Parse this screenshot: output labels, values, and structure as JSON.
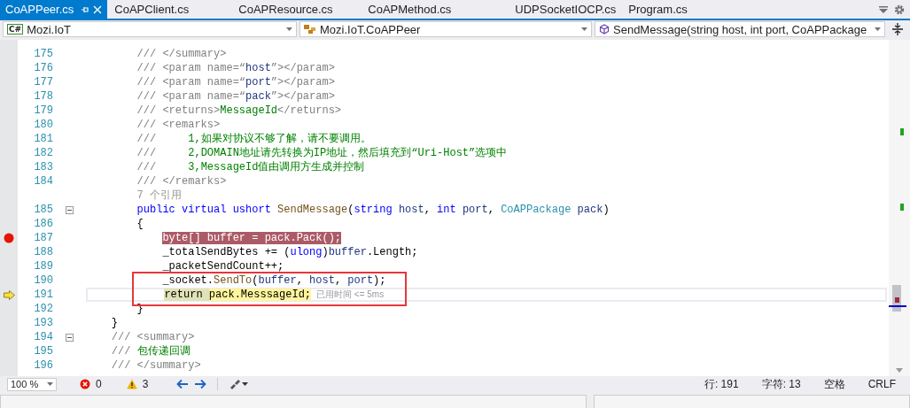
{
  "tabs": [
    {
      "label": "CoAPPeer.cs",
      "selected": true
    },
    {
      "label": "CoAPClient.cs",
      "selected": false
    },
    {
      "label": "CoAPResource.cs",
      "selected": false
    },
    {
      "label": "CoAPMethod.cs",
      "selected": false
    },
    {
      "label": "UDPSocketIOCP.cs",
      "selected": false
    },
    {
      "label": "Program.cs",
      "selected": false
    }
  ],
  "navigation_bar": {
    "project": {
      "icon_label": "C#",
      "text": "Mozi.IoT"
    },
    "type": {
      "text": "Mozi.IoT.CoAPPeer"
    },
    "member": {
      "text": "SendMessage(string host, int port, CoAPPackage"
    }
  },
  "editor": {
    "lines": [
      {
        "number": "175",
        "tokens": [
          {
            "text": "        /// </summary>",
            "kind": "doc"
          }
        ]
      },
      {
        "number": "176",
        "tokens": [
          {
            "text": "        /// <param name=“",
            "kind": "doc"
          },
          {
            "text": "host",
            "kind": "param"
          },
          {
            "text": "”></param>",
            "kind": "doc"
          }
        ]
      },
      {
        "number": "177",
        "tokens": [
          {
            "text": "        /// <param name=“",
            "kind": "doc"
          },
          {
            "text": "port",
            "kind": "param"
          },
          {
            "text": "”></param>",
            "kind": "doc"
          }
        ]
      },
      {
        "number": "178",
        "tokens": [
          {
            "text": "        /// <param name=“",
            "kind": "doc"
          },
          {
            "text": "pack",
            "kind": "param"
          },
          {
            "text": "”></param>",
            "kind": "doc"
          }
        ]
      },
      {
        "number": "179",
        "tokens": [
          {
            "text": "        /// <returns>",
            "kind": "doc"
          },
          {
            "text": "MessageId",
            "kind": "comment"
          },
          {
            "text": "</returns>",
            "kind": "doc"
          }
        ]
      },
      {
        "number": "180",
        "tokens": [
          {
            "text": "        /// <remarks>",
            "kind": "doc"
          }
        ]
      },
      {
        "number": "181",
        "tokens": [
          {
            "text": "        ///",
            "kind": "doc"
          },
          {
            "text": "     1,如果对协议不够了解，请不要调用。",
            "kind": "comment"
          }
        ]
      },
      {
        "number": "182",
        "tokens": [
          {
            "text": "        ///",
            "kind": "doc"
          },
          {
            "text": "     2,DOMAIN地址请先转换为IP地址，然后填充到“Uri-Host”选项中",
            "kind": "comment"
          }
        ]
      },
      {
        "number": "183",
        "tokens": [
          {
            "text": "        ///",
            "kind": "doc"
          },
          {
            "text": "     3,MessageId值由调用方生成并控制",
            "kind": "comment"
          }
        ]
      },
      {
        "number": "184",
        "tokens": [
          {
            "text": "        /// </remarks>",
            "kind": "doc"
          }
        ]
      },
      {
        "tokens": [
          {
            "text": "        7 个引用",
            "kind": "lens"
          }
        ]
      },
      {
        "number": "185",
        "collapsible": true,
        "tokens": [
          {
            "text": "        public virtual ushort",
            "kind": "keyword"
          },
          {
            "text": " SendMessage",
            "kind": "method"
          },
          {
            "text": "(",
            "kind": "plain"
          },
          {
            "text": "string",
            "kind": "keyword"
          },
          {
            "text": " host",
            "kind": "param"
          },
          {
            "text": ", ",
            "kind": "plain"
          },
          {
            "text": "int",
            "kind": "keyword"
          },
          {
            "text": " port",
            "kind": "param"
          },
          {
            "text": ", ",
            "kind": "plain"
          },
          {
            "text": "CoAPPackage",
            "kind": "type"
          },
          {
            "text": " pack",
            "kind": "param"
          },
          {
            "text": ")",
            "kind": "plain"
          }
        ]
      },
      {
        "number": "186",
        "tokens": [
          {
            "text": "        {",
            "kind": "plain"
          }
        ]
      },
      {
        "number": "187",
        "breakpoint": true,
        "tokens": [
          {
            "text": "            byte[] buffer = pack.Pack();",
            "kind": "breakpoint_highlight"
          }
        ]
      },
      {
        "number": "188",
        "tokens": [
          {
            "text": "            _totalSendBytes += (",
            "kind": "plain"
          },
          {
            "text": "ulong",
            "kind": "keyword"
          },
          {
            "text": ")",
            "kind": "plain"
          },
          {
            "text": "buffer",
            "kind": "param"
          },
          {
            "text": ".Length;",
            "kind": "plain"
          }
        ]
      },
      {
        "number": "189",
        "tokens": [
          {
            "text": "            _packetSendCount++;",
            "kind": "plain"
          }
        ]
      },
      {
        "number": "190",
        "tokens": [
          {
            "text": "            _socket.",
            "kind": "plain"
          },
          {
            "text": "SendTo",
            "kind": "method"
          },
          {
            "text": "(",
            "kind": "plain"
          },
          {
            "text": "buffer",
            "kind": "param"
          },
          {
            "text": ", ",
            "kind": "plain"
          },
          {
            "text": "host",
            "kind": "param"
          },
          {
            "text": ", ",
            "kind": "plain"
          },
          {
            "text": "port",
            "kind": "param"
          },
          {
            "text": ");",
            "kind": "plain"
          }
        ]
      },
      {
        "number": "191",
        "current": true,
        "perf_tip": "已用时间 <= 5ms",
        "tokens": [
          {
            "text": "            return ",
            "kind": "statement_highlight"
          },
          {
            "text": "pack.MesssageId;",
            "kind": "current_highlight"
          }
        ]
      },
      {
        "number": "192",
        "tokens": [
          {
            "text": "        }",
            "kind": "plain"
          }
        ]
      },
      {
        "number": "193",
        "tokens": [
          {
            "text": "    }",
            "kind": "plain"
          }
        ]
      },
      {
        "number": "194",
        "collapsible": true,
        "tokens": [
          {
            "text": "    /// <summary>",
            "kind": "doc"
          }
        ]
      },
      {
        "number": "195",
        "tokens": [
          {
            "text": "    ///",
            "kind": "doc"
          },
          {
            "text": " 包传递回调",
            "kind": "comment"
          }
        ]
      },
      {
        "number": "196",
        "tokens": [
          {
            "text": "    /// </summary>",
            "kind": "doc"
          }
        ]
      }
    ]
  },
  "status_bar": {
    "zoom": "100 %",
    "errors": "0",
    "warnings": "3",
    "line": "行: 191",
    "column": "字符: 13",
    "indent": "空格",
    "line_ending": "CRLF"
  }
}
